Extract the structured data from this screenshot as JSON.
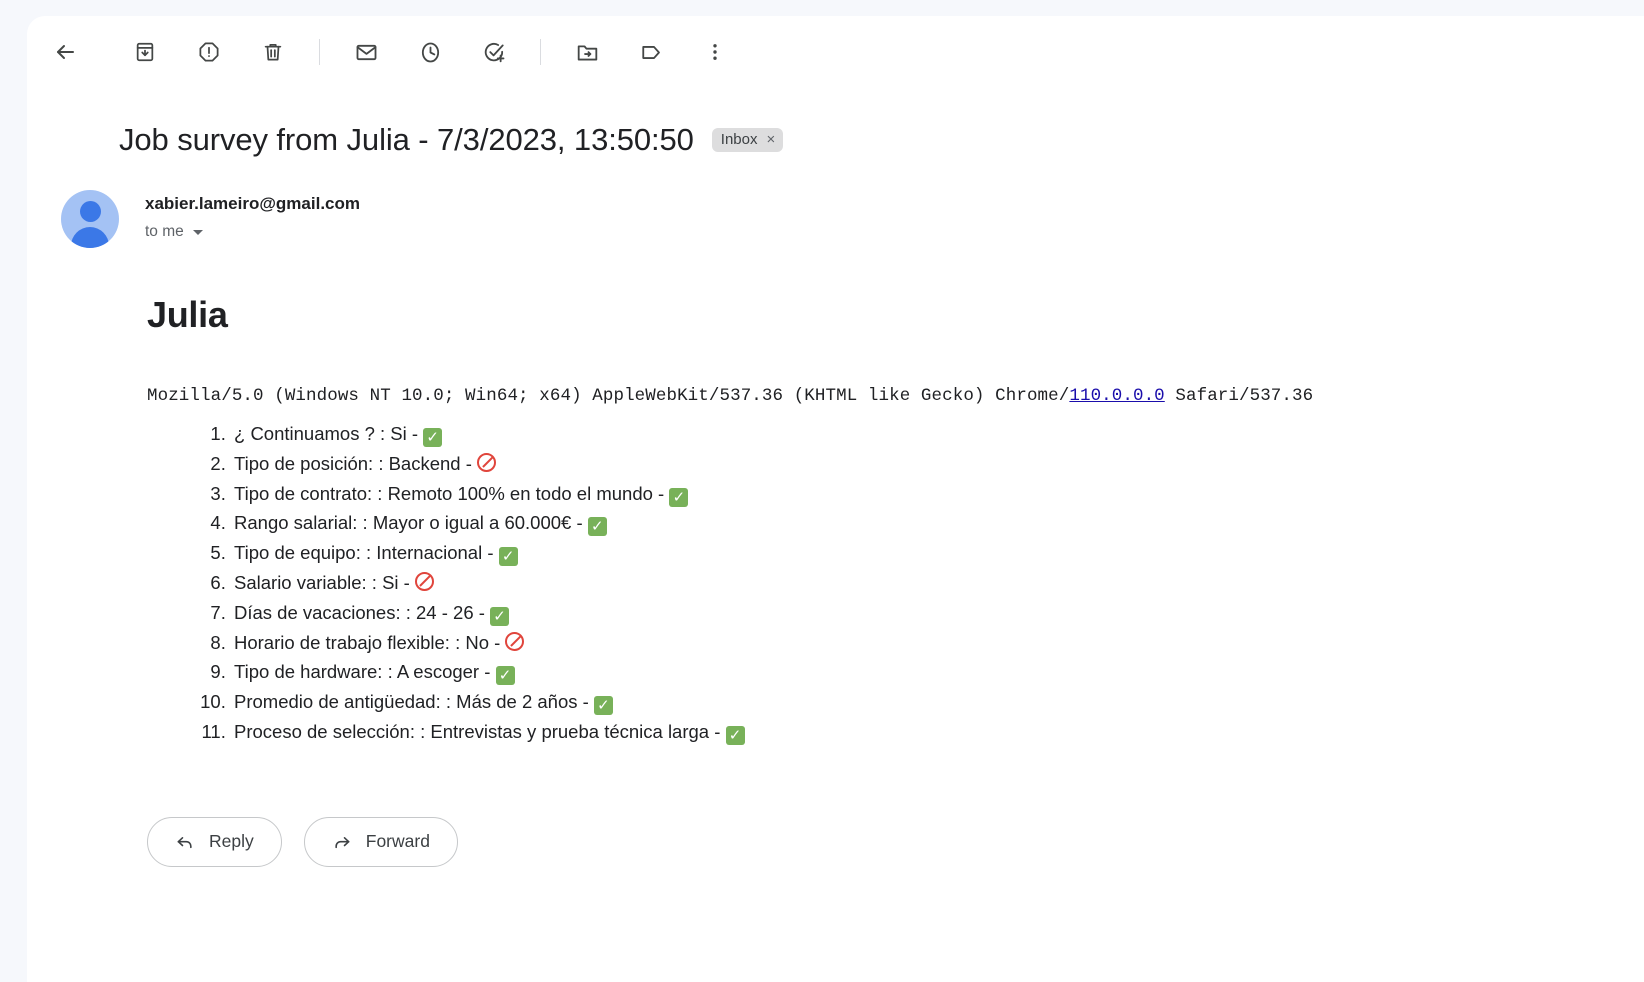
{
  "toolbar": {
    "items": [
      {
        "name": "back-button",
        "icon": "back-arrow-icon",
        "tooltip": "Back to Inbox"
      },
      {
        "name": "archive-button",
        "icon": "archive-icon",
        "tooltip": "Archive"
      },
      {
        "name": "report-spam-button",
        "icon": "report-spam-icon",
        "tooltip": "Report spam"
      },
      {
        "name": "delete-button",
        "icon": "trash-icon",
        "tooltip": "Delete"
      },
      {
        "name": "mark-unread-button",
        "icon": "envelope-icon",
        "tooltip": "Mark as unread"
      },
      {
        "name": "snooze-button",
        "icon": "clock-icon",
        "tooltip": "Snooze"
      },
      {
        "name": "add-to-tasks-button",
        "icon": "check-circle-plus-icon",
        "tooltip": "Add to Tasks"
      },
      {
        "name": "move-to-button",
        "icon": "folder-move-icon",
        "tooltip": "Move to"
      },
      {
        "name": "labels-button",
        "icon": "label-tag-icon",
        "tooltip": "Labels"
      },
      {
        "name": "more-button",
        "icon": "more-vertical-icon",
        "tooltip": "More"
      }
    ]
  },
  "subject": {
    "title": "Job survey from Julia - 7/3/2023, 13:50:50",
    "label_chip": "Inbox",
    "label_chip_remove": "×"
  },
  "sender": {
    "email": "xabier.lameiro@gmail.com",
    "recipients": "to me",
    "avatar_icon": "person-avatar-icon"
  },
  "mail_body": {
    "heading": "Julia",
    "user_agent_prefix": "Mozilla/5.0 (Windows NT 10.0; Win64; x64) AppleWebKit/537.36 (KHTML like Gecko) Chrome/",
    "user_agent_link": "110.0.0.0",
    "user_agent_suffix": " Safari/537.36",
    "survey": [
      {
        "text": "¿ Continuamos ? : Si - ",
        "status": "check"
      },
      {
        "text": "Tipo de posición: : Backend - ",
        "status": "ban"
      },
      {
        "text": "Tipo de contrato: : Remoto 100% en todo el mundo - ",
        "status": "check"
      },
      {
        "text": "Rango salarial: : Mayor o igual a 60.000€ - ",
        "status": "check"
      },
      {
        "text": "Tipo de equipo: : Internacional - ",
        "status": "check"
      },
      {
        "text": "Salario variable: : Si - ",
        "status": "ban"
      },
      {
        "text": "Días de vacaciones: : 24 - 26 - ",
        "status": "check"
      },
      {
        "text": "Horario de trabajo flexible: : No - ",
        "status": "ban"
      },
      {
        "text": "Tipo de hardware: : A escoger - ",
        "status": "check"
      },
      {
        "text": "Promedio de antigüedad: : Más de 2 años - ",
        "status": "check"
      },
      {
        "text": "Proceso de selección: : Entrevistas y prueba técnica larga - ",
        "status": "check"
      }
    ]
  },
  "actions": {
    "reply_label": "Reply",
    "forward_label": "Forward"
  },
  "colors": {
    "page_background": "#f6f8fc",
    "surface": "#ffffff",
    "text_primary": "#202124",
    "text_secondary": "#5f6368",
    "link": "#1a0dab",
    "chip_background": "#ddddde",
    "avatar_background": "#a4c2f4",
    "avatar_figure": "#3b78e7",
    "status_ok": "#78b159",
    "status_blocked": "#e0453c"
  }
}
